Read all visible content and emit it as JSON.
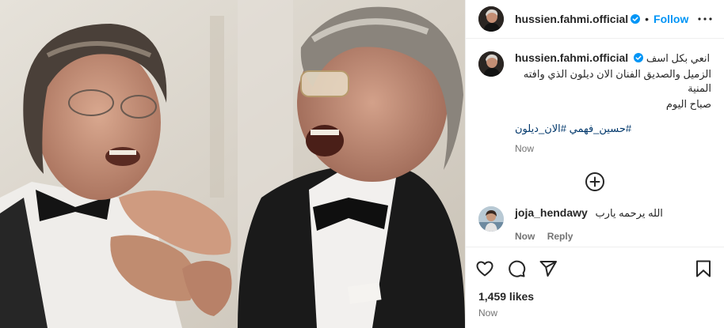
{
  "post": {
    "photo_alt": "",
    "author": {
      "username": "hussien.fahmi.official",
      "verified": true,
      "follow_label": "Follow",
      "separator": "•"
    },
    "caption": {
      "username": "hussien.fahmi.official",
      "text_line1": "انعي بكل اسف",
      "text_line2": "الزميل والصديق الفنان الان ديلون الذي وافته المنية",
      "text_line3": "صباح اليوم",
      "hashtags": "#حسين_فهمي #الان_ديلون",
      "time": "Now"
    },
    "comments": [
      {
        "username": "joja_hendawy",
        "text": "الله يرحمه يارب",
        "time": "Now",
        "reply_label": "Reply"
      }
    ],
    "icons": {
      "more": "more-dots-icon",
      "load_more": "plus-circle-icon",
      "like": "heart-icon",
      "comment": "comment-bubble-icon",
      "share": "paper-plane-icon",
      "save": "bookmark-icon",
      "verified": "verified-badge-icon"
    },
    "likes": "1,459 likes",
    "timestamp": "Now",
    "colors": {
      "accent": "#0095f6",
      "hashtag": "#00376b",
      "muted": "#737373",
      "text": "#262626"
    }
  }
}
